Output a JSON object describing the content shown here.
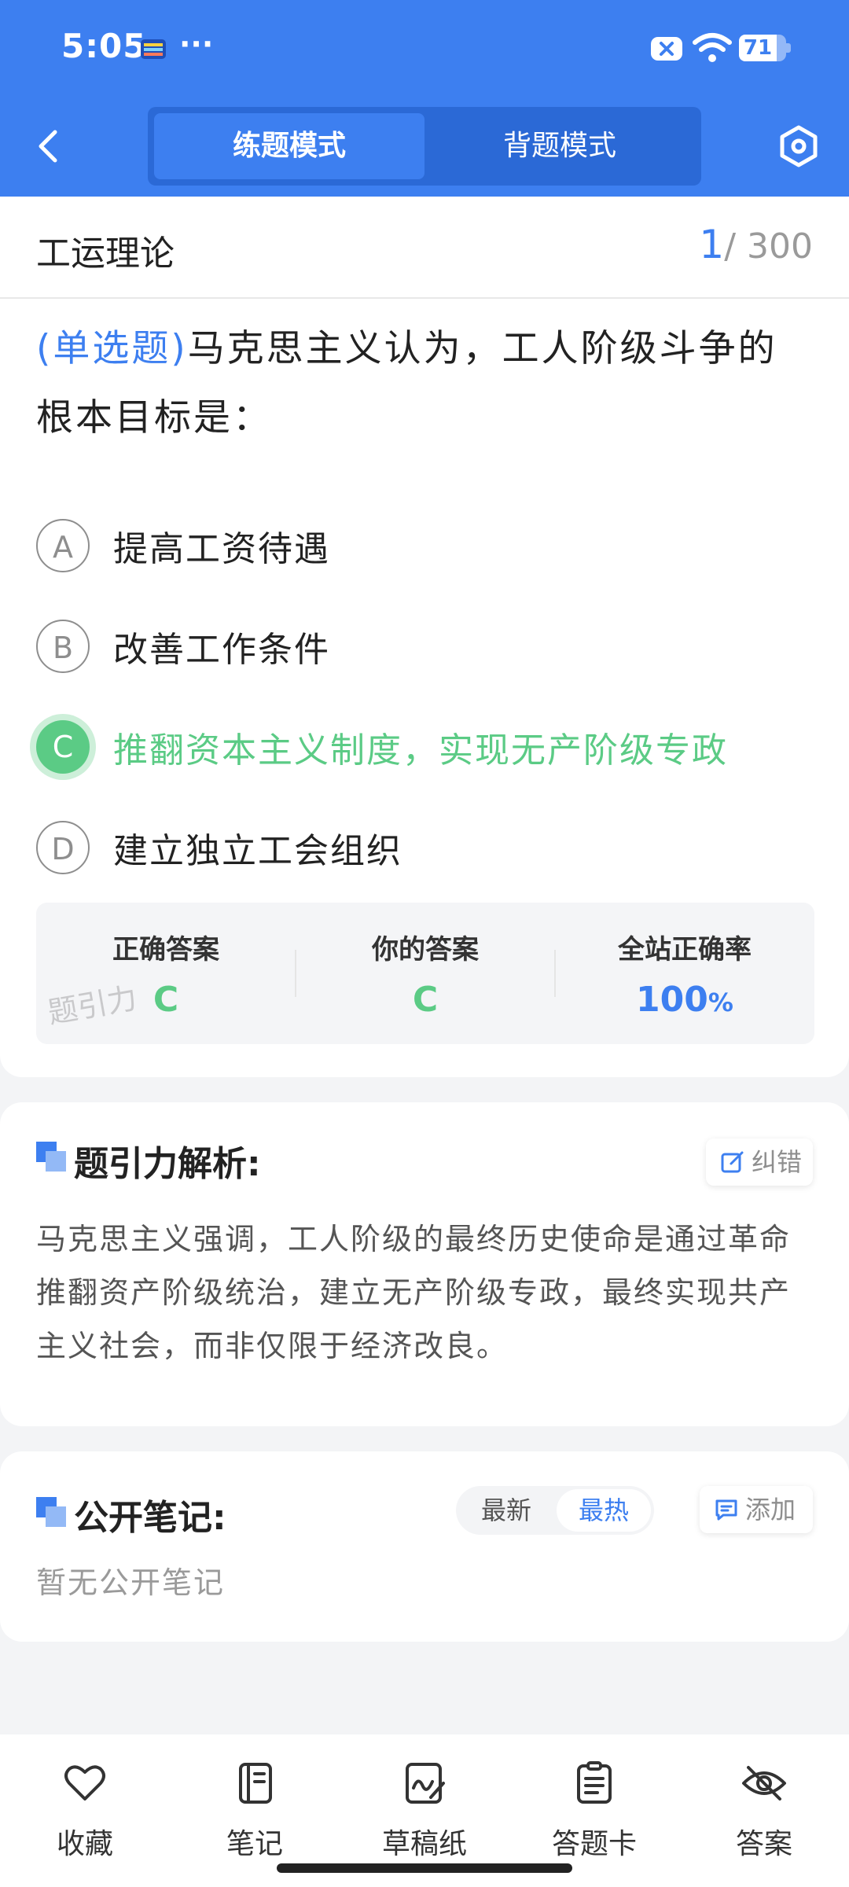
{
  "status_bar": {
    "time": "5:05",
    "dots": "···",
    "battery": "71"
  },
  "header": {
    "back_icon": "chevron-left-icon",
    "modes": [
      "练题模式",
      "背题模式"
    ],
    "active_mode": "练题模式",
    "settings_icon": "hexagon-settings-icon"
  },
  "question": {
    "subject": "工运理论",
    "current": "1",
    "total": "/ 300",
    "type": "(单选题)",
    "text": "马克思主义认为，工人阶级斗争的根本目标是：",
    "options": [
      {
        "key": "A",
        "text": "提高工资待遇"
      },
      {
        "key": "B",
        "text": "改善工作条件"
      },
      {
        "key": "C",
        "text": "推翻资本主义制度，实现无产阶级专政"
      },
      {
        "key": "D",
        "text": "建立独立工会组织"
      }
    ],
    "correct_key": "C"
  },
  "answer_summary": {
    "correct_label": "正确答案",
    "correct_value": "C",
    "yours_label": "你的答案",
    "yours_value": "C",
    "rate_label": "全站正确率",
    "rate_value": "100",
    "rate_unit": "%",
    "watermark": "题引力"
  },
  "analysis": {
    "title": "题引力解析:",
    "report_label": "纠错",
    "text": "马克思主义强调，工人阶级的最终历史使命是通过革命推翻资产阶级统治，建立无产阶级专政，最终实现共产主义社会，而非仅限于经济改良。"
  },
  "notes": {
    "title": "公开笔记:",
    "sort_options": [
      "最新",
      "最热"
    ],
    "active_sort": "最热",
    "add_label": "添加",
    "empty_text": "暂无公开笔记"
  },
  "bottom_nav": [
    {
      "label": "收藏",
      "icon": "heart-icon"
    },
    {
      "label": "笔记",
      "icon": "notebook-icon"
    },
    {
      "label": "草稿纸",
      "icon": "draft-paper-icon"
    },
    {
      "label": "答题卡",
      "icon": "answer-sheet-icon"
    },
    {
      "label": "答案",
      "icon": "eye-off-icon"
    }
  ],
  "colors": {
    "primary": "#3D7FF0",
    "correct": "#5BCB85",
    "background": "#F3F4F6"
  }
}
